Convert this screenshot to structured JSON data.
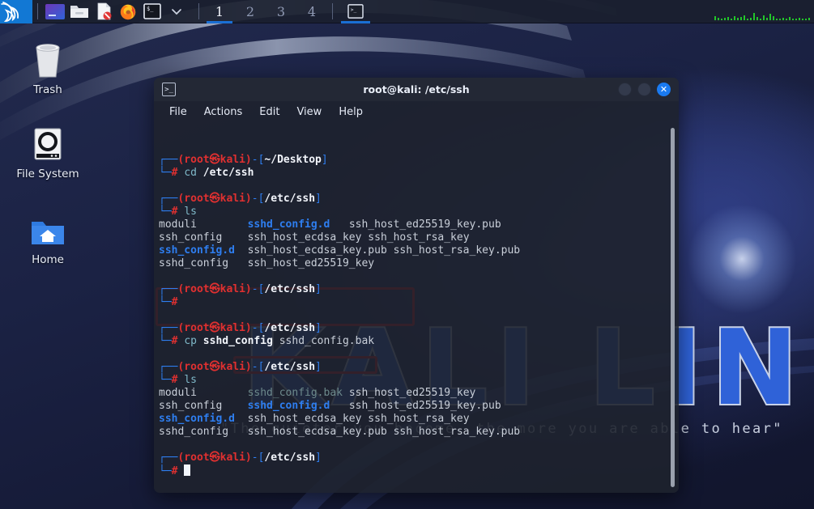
{
  "desktop": {
    "wallpaper": {
      "wordmark": "KALI LINUX",
      "quote": "\"The quieter you become, the more you are able to hear\"",
      "bg_color": "#1b2244",
      "accent_color": "#2f62d8"
    },
    "icons": [
      {
        "name": "trash",
        "label": "Trash"
      },
      {
        "name": "file-system",
        "label": "File System"
      },
      {
        "name": "home",
        "label": "Home"
      }
    ]
  },
  "panel": {
    "logo": "kali-dragon-logo",
    "launchers": [
      {
        "name": "app-purple",
        "icon": "terminal-purple-icon"
      },
      {
        "name": "file-manager",
        "icon": "folder-icon"
      },
      {
        "name": "text-editor",
        "icon": "document-icon"
      },
      {
        "name": "firefox",
        "icon": "firefox-icon"
      },
      {
        "name": "terminal",
        "icon": "terminal-icon"
      },
      {
        "name": "show-more",
        "icon": "chevron-down-icon"
      }
    ],
    "workspaces": [
      {
        "label": "1",
        "active": true
      },
      {
        "label": "2",
        "active": false
      },
      {
        "label": "3",
        "active": false
      },
      {
        "label": "4",
        "active": false
      }
    ],
    "tasks": [
      {
        "name": "terminal-window-task",
        "icon": "terminal-icon",
        "active": true
      }
    ],
    "sysmon": {
      "name": "network-monitor",
      "color": "#22c52a"
    }
  },
  "terminal": {
    "title": "root@kali: /etc/ssh",
    "icon": "terminal-icon",
    "window_buttons": {
      "minimize": "minimize-button",
      "maximize": "maximize-button",
      "close_label": "✕"
    },
    "menus": [
      "File",
      "Actions",
      "Edit",
      "View",
      "Help"
    ],
    "prompt": {
      "top_branch": "┌──",
      "bottom_branch": "└─",
      "user_host": "(root㉿kali)",
      "dash": "-[",
      "close": "]",
      "hash": "#"
    },
    "blocks": [
      {
        "id": "block-1",
        "path": "~/Desktop",
        "command_parts": [
          {
            "text": "cd ",
            "style": "cmd"
          },
          {
            "text": "/etc/ssh",
            "style": "white"
          }
        ],
        "output": []
      },
      {
        "id": "block-2",
        "path": "/etc/ssh",
        "command_parts": [
          {
            "text": "ls",
            "style": "cmd"
          }
        ],
        "output": [
          [
            {
              "text": "moduli",
              "style": "file"
            },
            {
              "text": "sshd_config.d",
              "style": "dir"
            },
            {
              "text": "ssh_host_ed25519_key.pub",
              "style": "file"
            }
          ],
          [
            {
              "text": "ssh_config",
              "style": "file"
            },
            {
              "text": "ssh_host_ecdsa_key",
              "style": "file"
            },
            {
              "text": "ssh_host_rsa_key",
              "style": "file"
            }
          ],
          [
            {
              "text": "ssh_config.d",
              "style": "dir"
            },
            {
              "text": "ssh_host_ecdsa_key.pub",
              "style": "file"
            },
            {
              "text": "ssh_host_rsa_key.pub",
              "style": "file"
            }
          ],
          [
            {
              "text": "sshd_config",
              "style": "file"
            },
            {
              "text": "ssh_host_ed25519_key",
              "style": "file"
            },
            {
              "text": "",
              "style": "file"
            }
          ]
        ]
      },
      {
        "id": "block-3",
        "path": "/etc/ssh",
        "command_parts": [],
        "output": []
      },
      {
        "id": "block-4",
        "path": "/etc/ssh",
        "highlighted": true,
        "command_parts": [
          {
            "text": "cp ",
            "style": "cmd"
          },
          {
            "text": "sshd_config",
            "style": "white"
          },
          {
            "text": " sshd_config.bak",
            "style": "file"
          }
        ],
        "output": []
      },
      {
        "id": "block-5",
        "path": "/etc/ssh",
        "command_parts": [
          {
            "text": "ls",
            "style": "cmd"
          }
        ],
        "output": [
          [
            {
              "text": "moduli",
              "style": "file"
            },
            {
              "text": "sshd_config.bak",
              "style": "bak"
            },
            {
              "text": "ssh_host_ed25519_key",
              "style": "file"
            }
          ],
          [
            {
              "text": "ssh_config",
              "style": "file"
            },
            {
              "text": "sshd_config.d",
              "style": "dir"
            },
            {
              "text": "ssh_host_ed25519_key.pub",
              "style": "file"
            }
          ],
          [
            {
              "text": "ssh_config.d",
              "style": "dir"
            },
            {
              "text": "ssh_host_ecdsa_key",
              "style": "file"
            },
            {
              "text": "ssh_host_rsa_key",
              "style": "file"
            }
          ],
          [
            {
              "text": "sshd_config",
              "style": "file"
            },
            {
              "text": "ssh_host_ecdsa_key.pub",
              "style": "file"
            },
            {
              "text": "ssh_host_rsa_key.pub",
              "style": "file"
            }
          ]
        ]
      },
      {
        "id": "block-6",
        "path": "/etc/ssh",
        "command_parts": [],
        "cursor": true,
        "output": []
      }
    ],
    "highlights": [
      {
        "name": "cp-command-highlight",
        "color": "#f41212"
      },
      {
        "name": "sshd-config-bak-highlight",
        "color": "#f41212"
      }
    ]
  }
}
